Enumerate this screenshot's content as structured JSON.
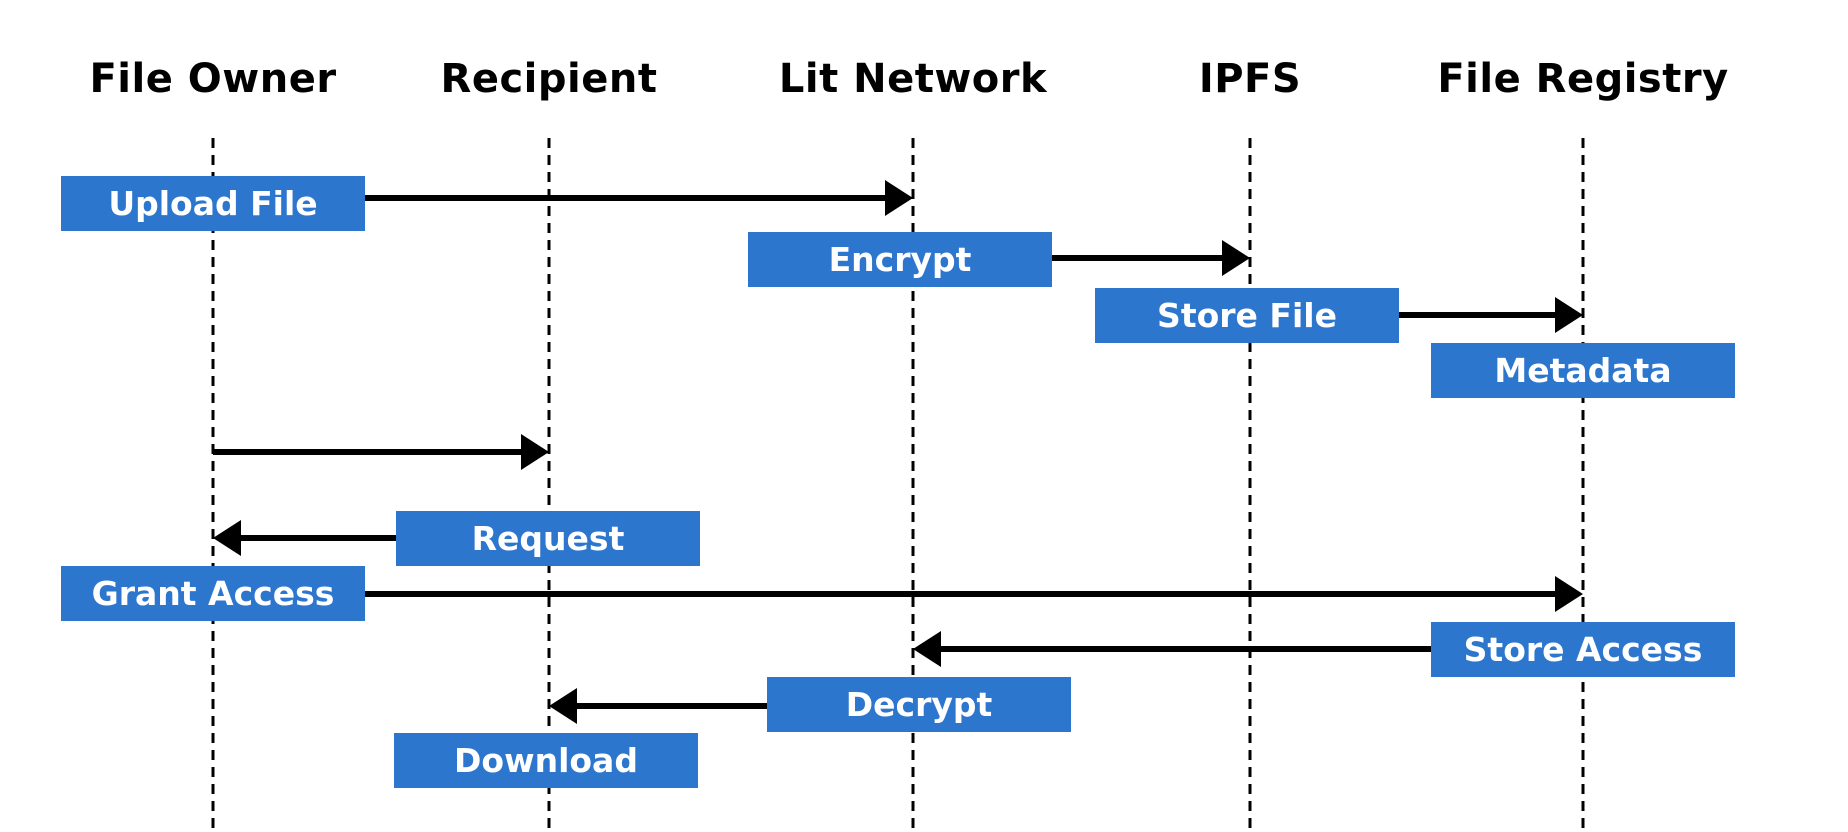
{
  "diagram": {
    "type": "sequence",
    "participants": [
      {
        "id": "owner",
        "label": "File Owner"
      },
      {
        "id": "recipient",
        "label": "Recipient"
      },
      {
        "id": "lit",
        "label": "Lit Network"
      },
      {
        "id": "ipfs",
        "label": "IPFS"
      },
      {
        "id": "registry",
        "label": "File Registry"
      }
    ],
    "steps": [
      {
        "label": "Upload File",
        "box_at": "owner",
        "from": "owner",
        "to": "lit"
      },
      {
        "label": "Encrypt",
        "box_at": "lit",
        "from": "lit",
        "to": "ipfs"
      },
      {
        "label": "Store File",
        "box_at": "ipfs",
        "from": "ipfs",
        "to": "registry"
      },
      {
        "label": "Metadata",
        "box_at": "registry",
        "from": null,
        "to": null
      },
      {
        "label": "",
        "box_at": null,
        "from": "owner",
        "to": "recipient"
      },
      {
        "label": "Request",
        "box_at": "recipient",
        "from": "recipient",
        "to": "owner"
      },
      {
        "label": "Grant Access",
        "box_at": "owner",
        "from": "owner",
        "to": "registry"
      },
      {
        "label": "Store Access",
        "box_at": "registry",
        "from": "registry",
        "to": "lit"
      },
      {
        "label": "Decrypt",
        "box_at": "lit",
        "from": "lit",
        "to": "recipient"
      },
      {
        "label": "Download",
        "box_at": "recipient",
        "from": null,
        "to": null
      }
    ],
    "colors": {
      "box_fill": "#2D76CE",
      "box_text": "#FFFFFF",
      "line": "#000000"
    }
  }
}
